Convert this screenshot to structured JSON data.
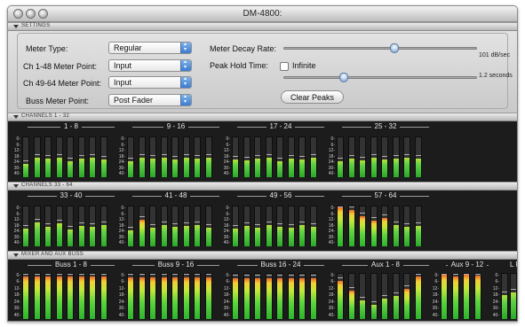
{
  "window": {
    "title": "DM-4800:"
  },
  "sections": {
    "settings": "SETTINGS",
    "ch1": "CHANNELS 1 - 32",
    "ch2": "CHANNELS 33 - 64",
    "buss": "MIXER AND AUX BUSS"
  },
  "settings": {
    "meter_type_label": "Meter Type:",
    "meter_type_value": "Regular",
    "ch148_label": "Ch 1-48 Meter Point:",
    "ch148_value": "Input",
    "ch4964_label": "Ch 49-64 Meter Point:",
    "ch4964_value": "Input",
    "buss_label": "Buss Meter Point:",
    "buss_value": "Post Fader",
    "decay_label": "Meter Decay Rate:",
    "decay_value": "101 dB/sec",
    "decay_fraction": 0.58,
    "peak_hold_label": "Peak Hold Time:",
    "infinite_label": "Infinite",
    "infinite_checked": false,
    "peak_hold_value": "1.2 seconds",
    "peak_hold_fraction": 0.3,
    "clear_peaks_label": "Clear Peaks"
  },
  "scale_ticks": [
    "0-",
    "6-",
    "12-",
    "18-",
    "24-",
    "30-",
    "40-"
  ],
  "rows": {
    "row1": {
      "groups": [
        {
          "label": "1 - 8",
          "levels": [
            0.33,
            0.48,
            0.46,
            0.48,
            0.4,
            0.46,
            0.48,
            0.44
          ]
        },
        {
          "label": "9 - 16",
          "levels": [
            0.4,
            0.48,
            0.46,
            0.48,
            0.44,
            0.48,
            0.46,
            0.48
          ]
        },
        {
          "label": "17 - 24",
          "levels": [
            0.44,
            0.42,
            0.46,
            0.48,
            0.4,
            0.46,
            0.44,
            0.48
          ]
        },
        {
          "label": "25 - 32",
          "levels": [
            0.4,
            0.46,
            0.42,
            0.48,
            0.44,
            0.46,
            0.48,
            0.46
          ]
        }
      ]
    },
    "row2": {
      "groups": [
        {
          "label": "33 - 40",
          "levels": [
            0.44,
            0.58,
            0.48,
            0.56,
            0.42,
            0.5,
            0.48,
            0.52
          ]
        },
        {
          "label": "41 - 48",
          "levels": [
            0.4,
            0.66,
            0.46,
            0.52,
            0.48,
            0.5,
            0.52,
            0.46
          ]
        },
        {
          "label": "49 - 56",
          "levels": [
            0.44,
            0.5,
            0.46,
            0.52,
            0.48,
            0.46,
            0.52,
            0.48
          ]
        },
        {
          "label": "57 - 64",
          "levels": [
            0.96,
            0.9,
            0.74,
            0.64,
            0.7,
            0.52,
            0.48,
            0.5
          ]
        }
      ]
    },
    "row3": {
      "groups": [
        {
          "label": "Buss 1 - 8",
          "levels": [
            0.92,
            0.92,
            0.92,
            0.92,
            0.92,
            0.92,
            0.92,
            0.92
          ]
        },
        {
          "label": "Buss 9 - 16",
          "levels": [
            0.9,
            0.9,
            0.9,
            0.9,
            0.9,
            0.9,
            0.9,
            0.9
          ]
        },
        {
          "label": "Buss 16 - 24",
          "levels": [
            0.88,
            0.88,
            0.88,
            0.88,
            0.88,
            0.88,
            0.88,
            0.88
          ]
        },
        {
          "label": "Aux 1 - 8",
          "levels": [
            0.82,
            0.62,
            0.4,
            0.3,
            0.44,
            0.5,
            0.66,
            0.92
          ]
        },
        {
          "label": "Aux 9 - 12",
          "levels": [
            0.96,
            0.92,
            0.96,
            0.94
          ]
        },
        {
          "label": "L R",
          "levels": [
            0.52,
            0.58
          ]
        }
      ]
    }
  }
}
